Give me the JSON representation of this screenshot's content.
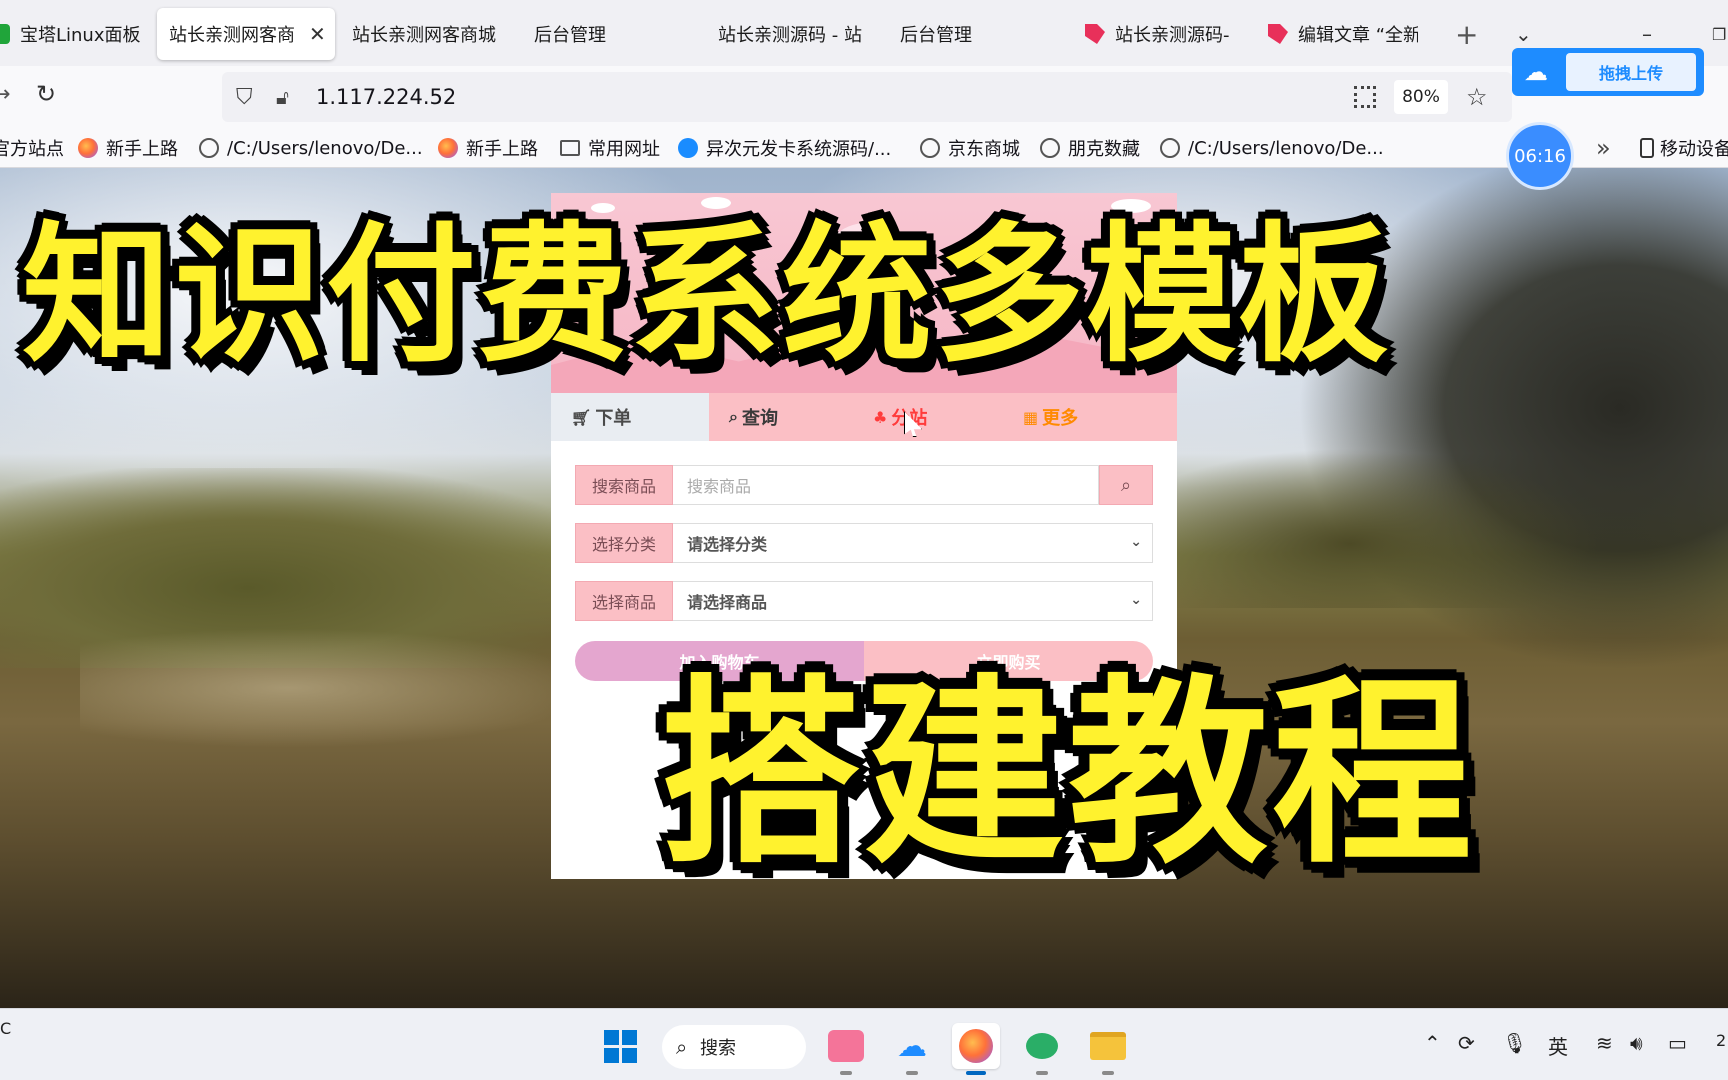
{
  "browser": {
    "tabs": [
      {
        "label": "宝塔Linux面板",
        "active": false
      },
      {
        "label": "站长亲测网客商",
        "active": true
      },
      {
        "label": "站长亲测网客商城",
        "active": false
      },
      {
        "label": "后台管理",
        "active": false
      },
      {
        "label": "站长亲测源码 - 站",
        "active": false
      },
      {
        "label": "后台管理",
        "active": false
      },
      {
        "label": "站长亲测源码-",
        "active": false
      },
      {
        "label": "编辑文章 “全新",
        "active": false
      }
    ],
    "new_tab": "+",
    "url": "1.117.224.52",
    "zoom": "80%",
    "bookmarks": [
      {
        "label": "官方站点",
        "icon": "none"
      },
      {
        "label": "新手上路",
        "icon": "firefox-icon"
      },
      {
        "label": "/C:/Users/lenovo/De...",
        "icon": "globe-icon"
      },
      {
        "label": "新手上路",
        "icon": "firefox-icon"
      },
      {
        "label": "常用网址",
        "icon": "folder-icon"
      },
      {
        "label": "异次元发卡系统源码/...",
        "icon": "download-icon"
      },
      {
        "label": "京东商城",
        "icon": "globe-icon"
      },
      {
        "label": "朋克数藏",
        "icon": "globe-icon"
      },
      {
        "label": "/C:/Users/lenovo/De...",
        "icon": "globe-icon"
      }
    ],
    "bookmarks_more": "»",
    "mobile_bookmarks": "移动设备"
  },
  "overlay": {
    "upload_label": "拖拽上传",
    "timer": "06:16",
    "title_top": "知识付费系统多模板",
    "title_bottom": "搭建教程"
  },
  "shop": {
    "tabs": {
      "order": "下单",
      "query": "查询",
      "site": "分站",
      "more": "更多"
    },
    "search": {
      "label": "搜索商品",
      "placeholder": "搜索商品"
    },
    "category": {
      "label": "选择分类",
      "value": "请选择分类"
    },
    "product": {
      "label": "选择商品",
      "value": "请选择商品"
    },
    "add_cart": "加入购物车",
    "buy_now": "立即购买"
  },
  "taskbar": {
    "search_label": "搜索",
    "ime": "英",
    "clock_fragment": "2",
    "temp_fragment": "C"
  },
  "colors": {
    "title_yellow": "#fff22e",
    "shop_pink": "#fbbfc5",
    "cart_purple": "#e4a6cf",
    "upload_blue": "#1e8cff"
  }
}
